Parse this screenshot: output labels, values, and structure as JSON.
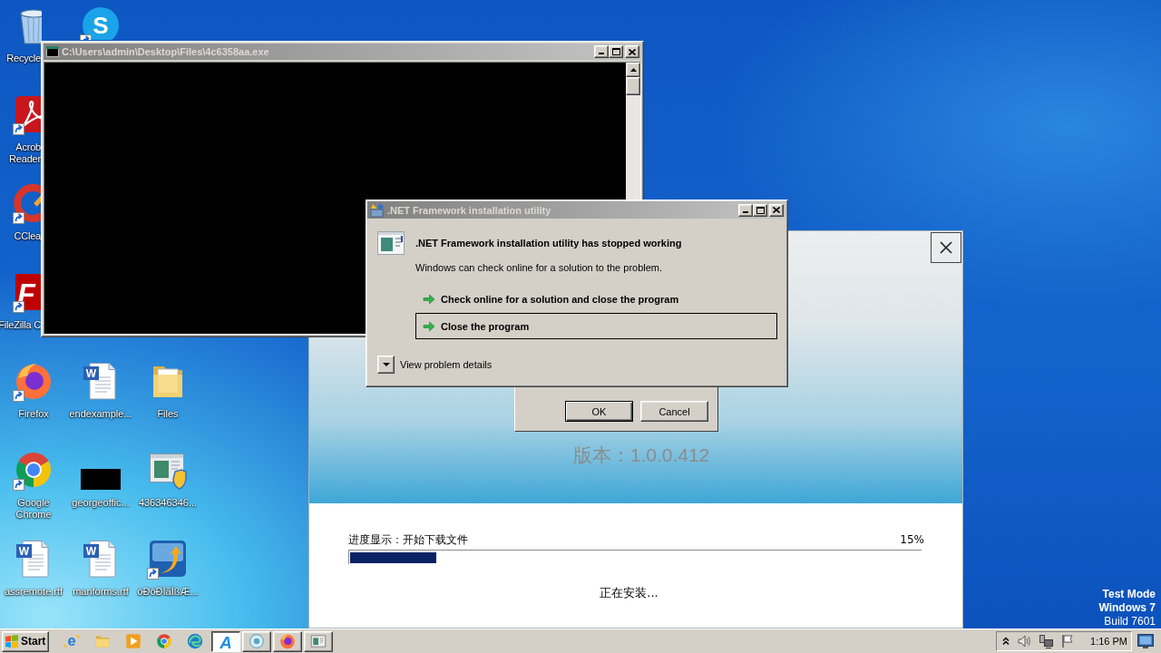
{
  "desktop_icons": [
    {
      "kind": "bin",
      "label": "Recycle",
      "shortcut": false
    },
    {
      "kind": "skype",
      "glyph": "S",
      "shortcut": true
    },
    {
      "kind": "acrobat",
      "label": "Acrob\nReader",
      "shortcut": true
    },
    {
      "kind": "cleaner",
      "label": "CClea",
      "shortcut": true
    },
    {
      "kind": "filezilla",
      "glyph": "F",
      "label": "FileZilla C",
      "shortcut": true
    },
    {
      "kind": "firefox",
      "label": "Firefox",
      "shortcut": true
    },
    {
      "kind": "document",
      "glyph": "W",
      "label": "endexample...",
      "shortcut": false
    },
    {
      "kind": "folder",
      "label": "Files",
      "shortcut": false
    },
    {
      "kind": "chrome",
      "label": "Google Chrome",
      "shortcut": true
    },
    {
      "kind": "blank",
      "label": "georgeoffic...",
      "shortcut": false
    },
    {
      "kind": "setup",
      "label": "436346346...",
      "shortcut": false
    },
    {
      "kind": "document",
      "glyph": "W",
      "label": "assremote.rtf",
      "shortcut": false
    },
    {
      "kind": "document",
      "glyph": "W",
      "label": "manforms.rtf",
      "shortcut": false
    },
    {
      "kind": "updater",
      "label": "òÐòÐÌãÌßÆ...",
      "shortcut": true
    }
  ],
  "console_window": {
    "title": "C:\\Users\\admin\\Desktop\\Files\\4c6358aa.exe"
  },
  "installer_window": {
    "version": "版本：1.0.0.412",
    "progress_label": "进度显示：开始下载文件",
    "progress_percent": "15%",
    "progress": {
      "level": 0.15
    },
    "status": "正在安装..."
  },
  "message_box": {
    "buttons": [
      {
        "label": "OK",
        "default": true
      },
      {
        "label": "Cancel",
        "default": false
      }
    ]
  },
  "error_dialog": {
    "title": ".NET Framework installation utility",
    "heading": ".NET Framework installation utility has stopped working",
    "message": "Windows can check online for a solution to the problem.",
    "options": [
      {
        "label": "Check online for a solution and close the program",
        "selected": false
      },
      {
        "label": "Close the program",
        "selected": true
      }
    ],
    "details_toggle": "View problem details"
  },
  "test_mode_notice": [
    {
      "text": "Test Mode",
      "bold": true
    },
    {
      "text": "Windows 7",
      "bold": true
    },
    {
      "text": "Build 7601",
      "bold": false
    }
  ],
  "taskbar": {
    "start_label": "Start",
    "quick_launch": [
      {
        "kind": "ie",
        "glyph": "e"
      },
      {
        "kind": "explorer"
      },
      {
        "kind": "media"
      },
      {
        "kind": "chrome"
      },
      {
        "kind": "edge"
      }
    ],
    "tasks": [
      {
        "kind": "arrow",
        "glyph": "A",
        "selected": true
      },
      {
        "kind": "disc",
        "selected": false
      },
      {
        "kind": "firefox",
        "selected": false
      },
      {
        "kind": "console",
        "selected": false
      }
    ],
    "tray": {
      "clock": "1:16 PM"
    }
  }
}
